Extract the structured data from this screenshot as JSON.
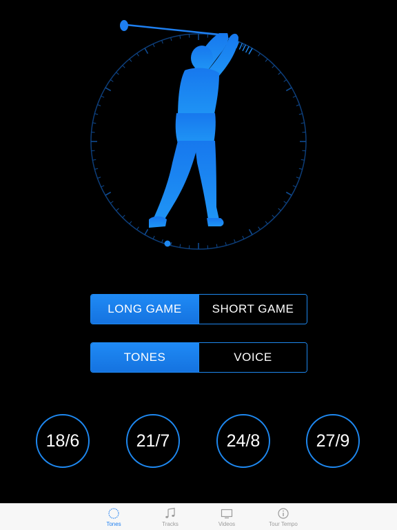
{
  "mode_selector": {
    "options": [
      "LONG GAME",
      "SHORT GAME"
    ],
    "selected": "LONG GAME"
  },
  "audio_selector": {
    "options": [
      "TONES",
      "VOICE"
    ],
    "selected": "TONES"
  },
  "tempo_ratios": [
    "18/6",
    "21/7",
    "24/8",
    "27/9"
  ],
  "tab_bar": {
    "tabs": [
      {
        "label": "Tones",
        "icon": "dial-icon",
        "active": true
      },
      {
        "label": "Tracks",
        "icon": "music-note-icon",
        "active": false
      },
      {
        "label": "Videos",
        "icon": "tv-icon",
        "active": false
      },
      {
        "label": "Tour Tempo",
        "icon": "info-icon",
        "active": false
      }
    ]
  },
  "colors": {
    "accent": "#1e88f0",
    "background": "#000000",
    "tab_bar_bg": "#f7f7f7",
    "tab_inactive": "#9a9a9a"
  }
}
